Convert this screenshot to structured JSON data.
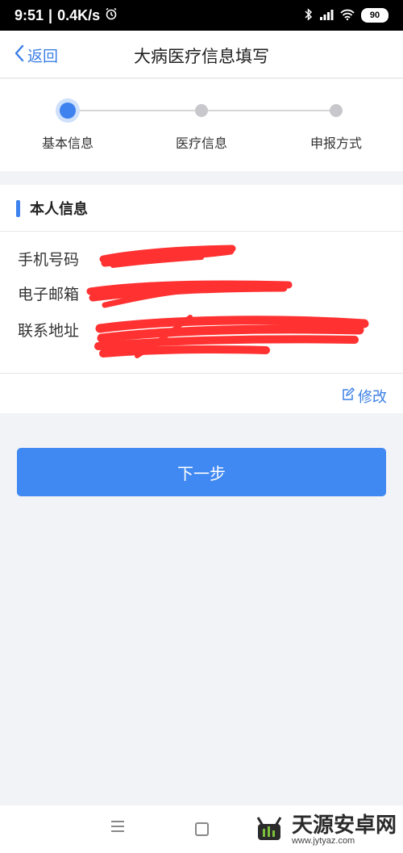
{
  "status_bar": {
    "time": "9:51",
    "net_speed": "0.4K/s",
    "battery": "90"
  },
  "nav": {
    "back_label": "返回",
    "title": "大病医疗信息填写"
  },
  "steps": [
    {
      "label": "基本信息"
    },
    {
      "label": "医疗信息"
    },
    {
      "label": "申报方式"
    }
  ],
  "personal_info": {
    "section_title": "本人信息",
    "fields": [
      {
        "label": "手机号码",
        "value": ""
      },
      {
        "label": "电子邮箱",
        "value": ""
      },
      {
        "label": "联系地址",
        "value": ""
      }
    ],
    "edit_label": "修改"
  },
  "actions": {
    "next_label": "下一步"
  },
  "watermark": {
    "main": "天源安卓网",
    "sub": "www.jytyaz.com"
  },
  "colors": {
    "accent": "#4088f2",
    "step_active": "#3d82ee",
    "scribble": "#ff2a2a"
  }
}
